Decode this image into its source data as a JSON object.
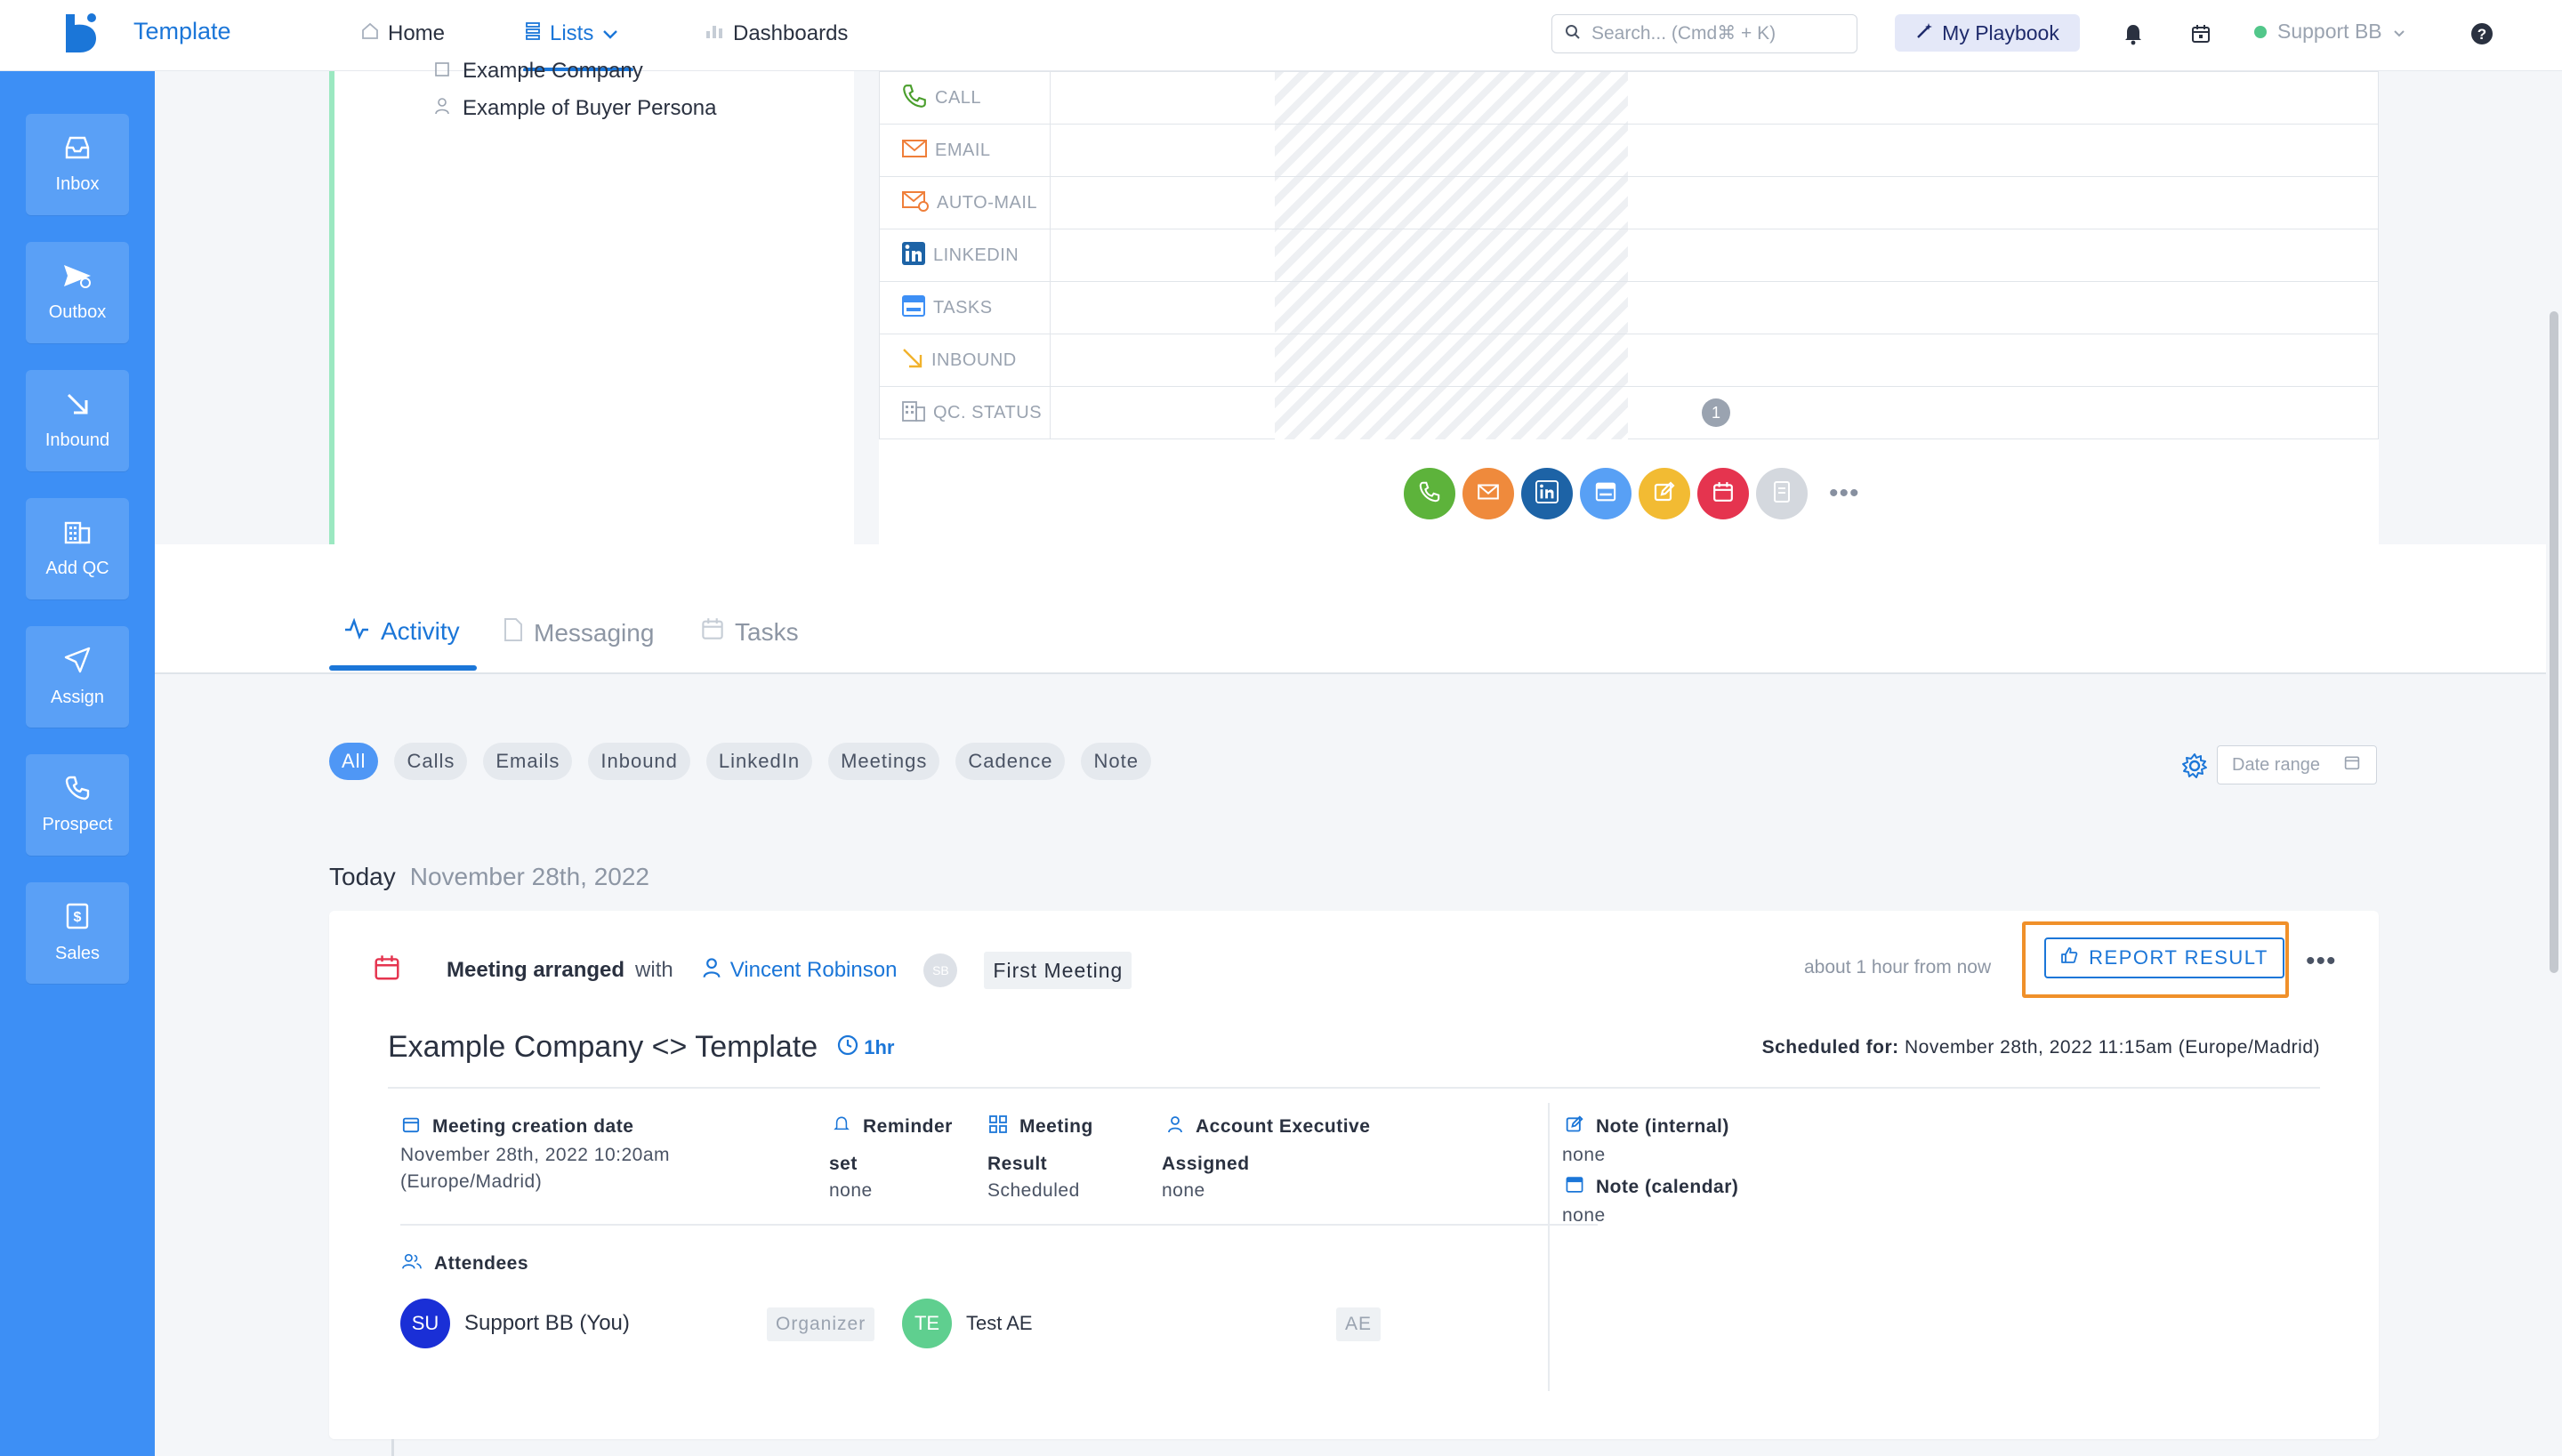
{
  "app": {
    "brand": "Template"
  },
  "nav": {
    "home": "Home",
    "lists": "Lists",
    "dashboards": "Dashboards",
    "search_placeholder": "Search... (Cmd⌘ + K)",
    "playbook": "My Playbook",
    "user": "Support BB"
  },
  "sidebar": {
    "items": [
      {
        "label": "Inbox"
      },
      {
        "label": "Outbox"
      },
      {
        "label": "Inbound"
      },
      {
        "label": "Add QC"
      },
      {
        "label": "Assign"
      },
      {
        "label": "Prospect"
      },
      {
        "label": "Sales"
      }
    ]
  },
  "left_card": {
    "items": [
      "Example Company",
      "Example of Buyer Persona"
    ]
  },
  "channels": {
    "rows": [
      "CALL",
      "EMAIL",
      "AUTO-MAIL",
      "LINKEDIN",
      "TASKS",
      "INBOUND",
      "QC. STATUS"
    ],
    "qc_badge": "1"
  },
  "tabs": {
    "activity": "Activity",
    "messaging": "Messaging",
    "tasks": "Tasks"
  },
  "filters": {
    "chips": [
      "All",
      "Calls",
      "Emails",
      "Inbound",
      "LinkedIn",
      "Meetings",
      "Cadence",
      "Note"
    ],
    "date_range_placeholder": "Date range"
  },
  "day": {
    "label": "Today",
    "date": "November 28th, 2022"
  },
  "activity": {
    "event": "Meeting arranged",
    "with": "with",
    "contact": "Vincent Robinson",
    "owner_initials": "SB",
    "type": "First Meeting",
    "time_ago": "about 1 hour from now",
    "report_button": "REPORT RESULT",
    "title": "Example Company <> Template",
    "duration": "1hr",
    "scheduled_label": "Scheduled for:",
    "scheduled_value": "November 28th, 2022 11:15am (Europe/Madrid)",
    "creation_label": "Meeting creation date",
    "creation_value_1": "November 28th, 2022 10:20am",
    "creation_value_2": "(Europe/Madrid)",
    "reminder_label": "Reminder",
    "reminder_sub": "set",
    "reminder_value": "none",
    "meeting_label": "Meeting",
    "meeting_sub": "Result",
    "meeting_value": "Scheduled",
    "ae_label": "Account Executive",
    "ae_sub": "Assigned",
    "ae_value": "none",
    "note_internal_label": "Note (internal)",
    "note_internal_value": "none",
    "note_calendar_label": "Note (calendar)",
    "note_calendar_value": "none",
    "attendees_label": "Attendees",
    "attendees": [
      {
        "initials": "SU",
        "name": "Support BB (You)",
        "role": "Organizer",
        "color": "#1a2fd6"
      },
      {
        "initials": "TE",
        "name": "Test AE",
        "role": "AE",
        "color": "#5fcf8f"
      }
    ]
  },
  "colors": {
    "accent": "#1b76d8",
    "sidebar": "#3d8ff5",
    "highlight": "#f0902a"
  }
}
